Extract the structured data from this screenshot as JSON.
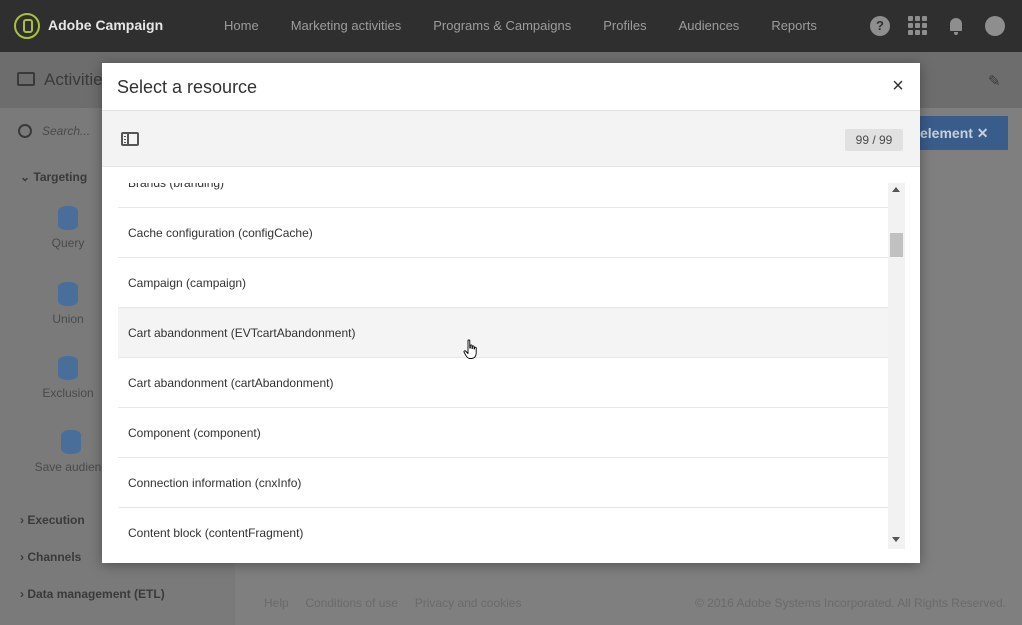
{
  "app": {
    "brand": "Adobe Campaign",
    "nav": [
      "Home",
      "Marketing activities",
      "Programs & Campaigns",
      "Profiles",
      "Audiences",
      "Reports"
    ],
    "help_glyph": "?"
  },
  "background": {
    "page_title": "Activitie",
    "search_placeholder": "Search...",
    "categories": [
      "Targeting",
      "Execution",
      "Channels",
      "Data management (ETL)"
    ],
    "activities": [
      "Query",
      "Union",
      "Exclusion",
      "Save audienc"
    ],
    "canvas_button": "element",
    "footer_links": [
      "Help",
      "Conditions of use",
      "Privacy and cookies"
    ],
    "copyright": "© 2016 Adobe Systems Incorporated. All Rights Reserved."
  },
  "modal": {
    "title": "Select a resource",
    "close_glyph": "×",
    "count": "99 / 99",
    "items": [
      "Brands (branding)",
      "Cache configuration (configCache)",
      "Campaign (campaign)",
      "Cart abandonment (EVTcartAbandonment)",
      "Cart abandonment (cartAbandonment)",
      "Component (component)",
      "Connection information (cnxInfo)",
      "Content block (contentFragment)"
    ],
    "hovered_index": 3
  },
  "colors": {
    "topbar": "#2f2f2f",
    "brand_accent": "#a8c23c",
    "overlay": "#7f7f7f",
    "primary_button": "#3a5c8a"
  }
}
